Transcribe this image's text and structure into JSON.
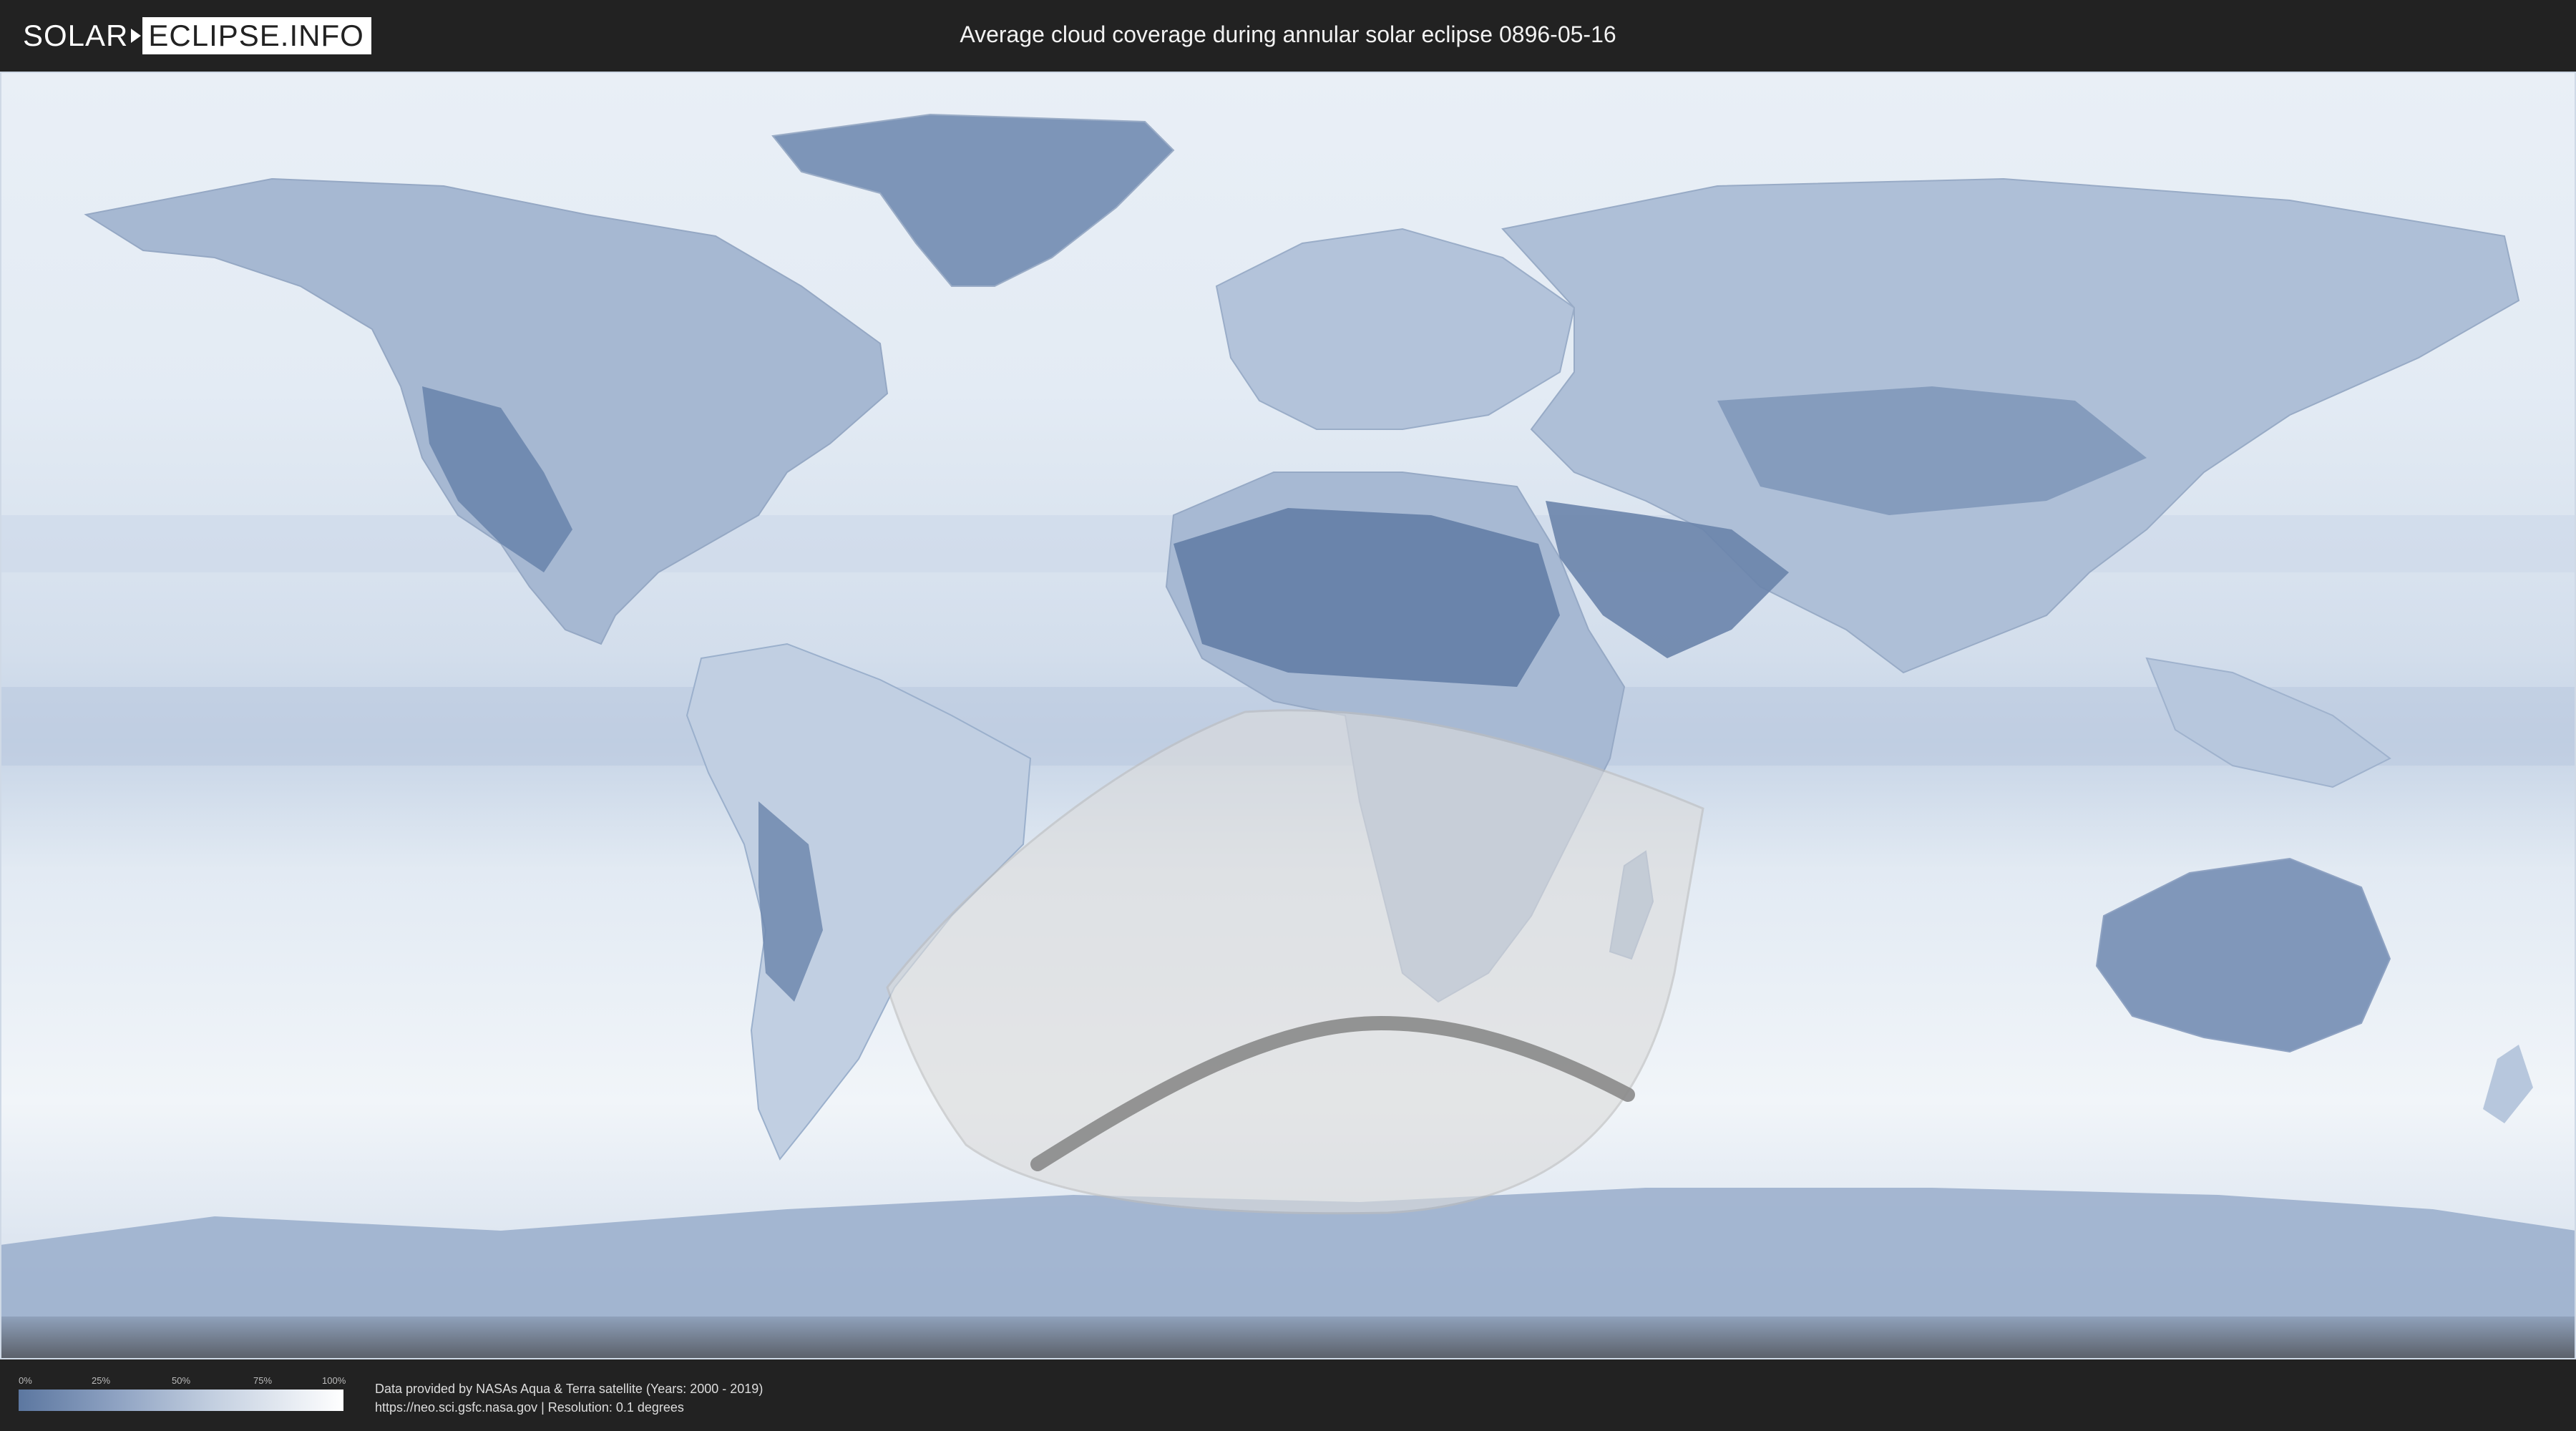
{
  "header": {
    "logo_left": "SOLAR",
    "logo_right": "ECLIPSE.INFO",
    "title": "Average cloud coverage during annular solar eclipse 0896-05-16"
  },
  "legend": {
    "ticks": [
      "0%",
      "25%",
      "50%",
      "75%",
      "100%"
    ],
    "color_low": "#5c77a0",
    "color_high": "#ffffff"
  },
  "footer": {
    "credit_line1": "Data provided by NASAs Aqua & Terra satellite (Years: 2000 - 2019)",
    "credit_line2": "https://neo.sci.gsfc.nasa.gov | Resolution: 0.1 degrees"
  },
  "colors": {
    "background": "#222222",
    "ocean_cloud": "#e6edf5",
    "land_clear": "#6f88ae",
    "eclipse_zone": "#d9d9d9",
    "eclipse_path": "#8a8a8a"
  }
}
